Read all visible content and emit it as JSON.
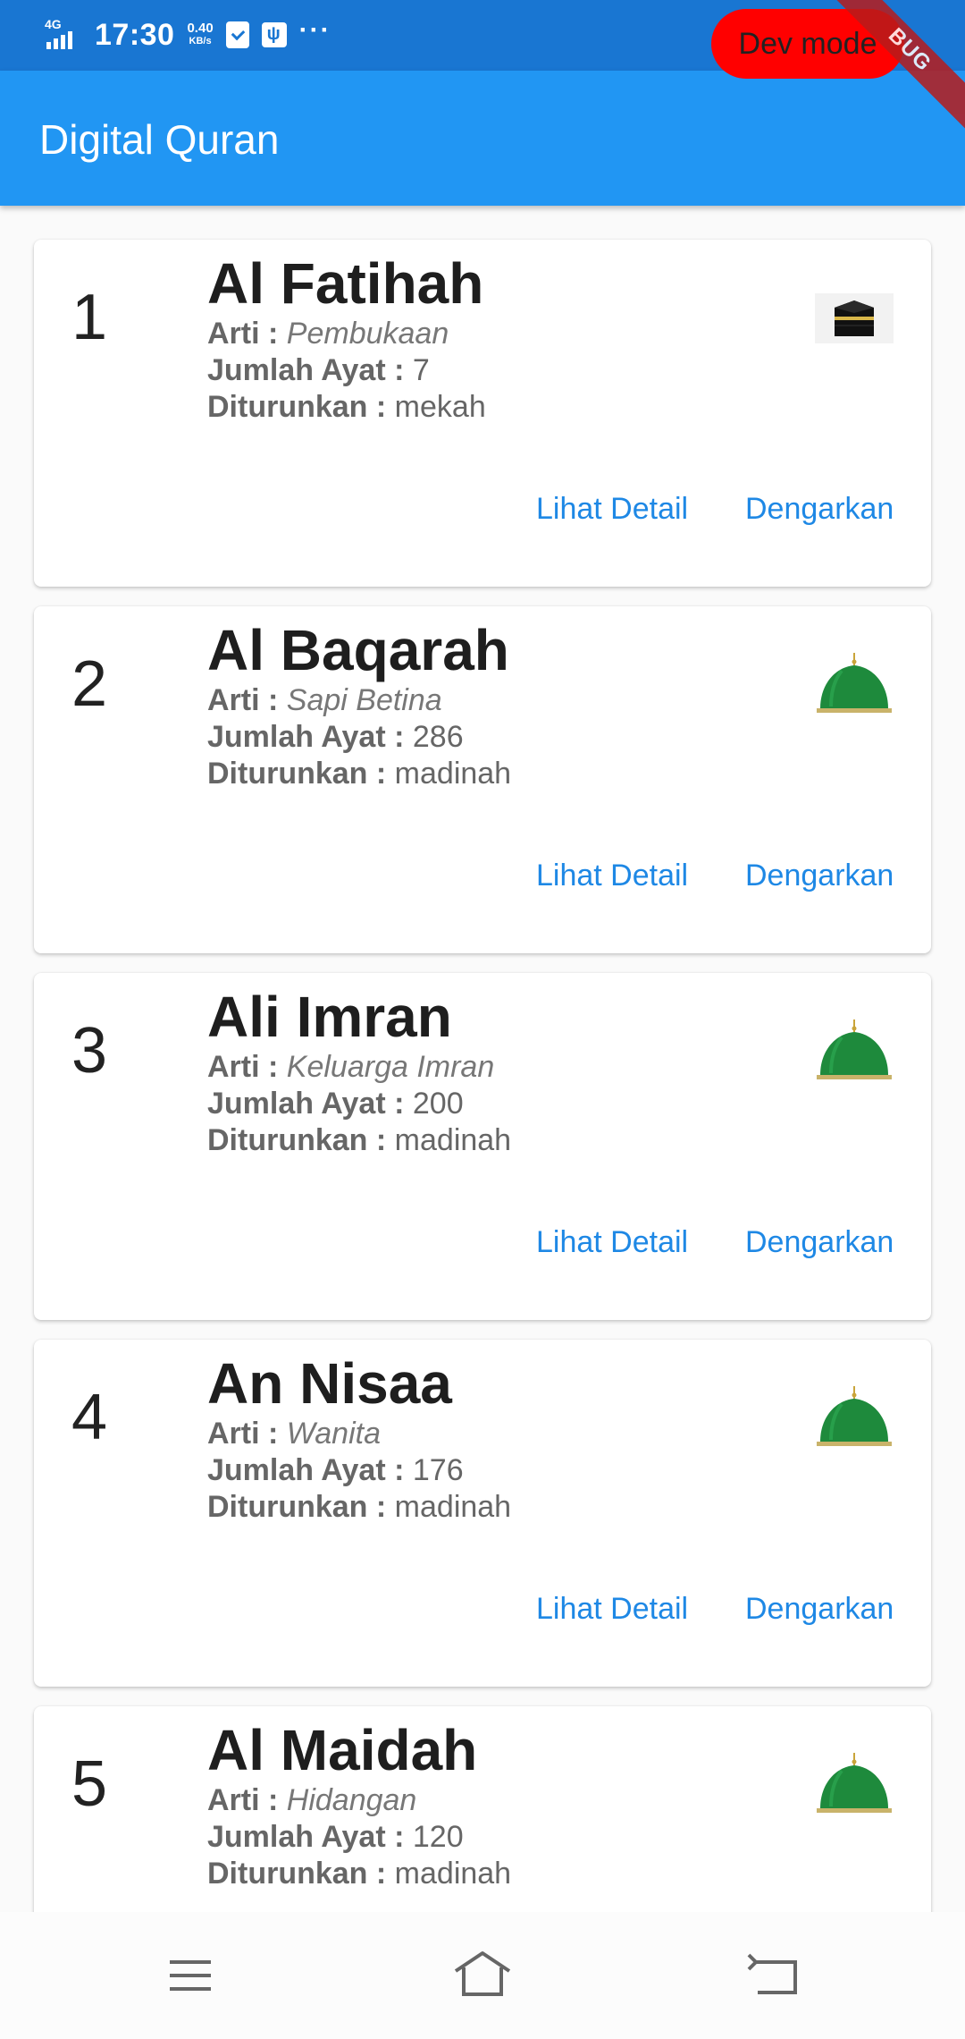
{
  "status_bar": {
    "network": "4G",
    "time": "17:30",
    "speed_value": "0.40",
    "speed_unit": "KB/s",
    "more": "···"
  },
  "dev_mode_label": "Dev mode",
  "debug_banner": "BUG",
  "app_bar": {
    "title": "Digital Quran"
  },
  "labels": {
    "arti": "Arti :",
    "jumlah_ayat": "Jumlah Ayat :",
    "diturunkan": "Diturunkan :",
    "lihat_detail": "Lihat Detail",
    "dengarkan": "Dengarkan"
  },
  "surahs": [
    {
      "number": "1",
      "name": "Al Fatihah",
      "arti": "Pembukaan",
      "ayat": "7",
      "diturunkan": "mekah",
      "icon": "kaaba-icon"
    },
    {
      "number": "2",
      "name": "Al Baqarah",
      "arti": "Sapi Betina",
      "ayat": "286",
      "diturunkan": "madinah",
      "icon": "green-dome-icon"
    },
    {
      "number": "3",
      "name": "Ali Imran",
      "arti": "Keluarga Imran",
      "ayat": "200",
      "diturunkan": "madinah",
      "icon": "green-dome-icon"
    },
    {
      "number": "4",
      "name": "An Nisaa",
      "arti": "Wanita",
      "ayat": "176",
      "diturunkan": "madinah",
      "icon": "green-dome-icon"
    },
    {
      "number": "5",
      "name": "Al Maidah",
      "arti": "Hidangan",
      "ayat": "120",
      "diturunkan": "madinah",
      "icon": "green-dome-icon"
    }
  ],
  "nav_bar": {
    "icons": [
      "menu-icon",
      "home-icon",
      "back-icon"
    ]
  },
  "colors": {
    "app_bar": "#2196f3",
    "status_bar": "#1976d2",
    "button_text": "#1e88e5",
    "dev_mode": "#ff0000"
  }
}
